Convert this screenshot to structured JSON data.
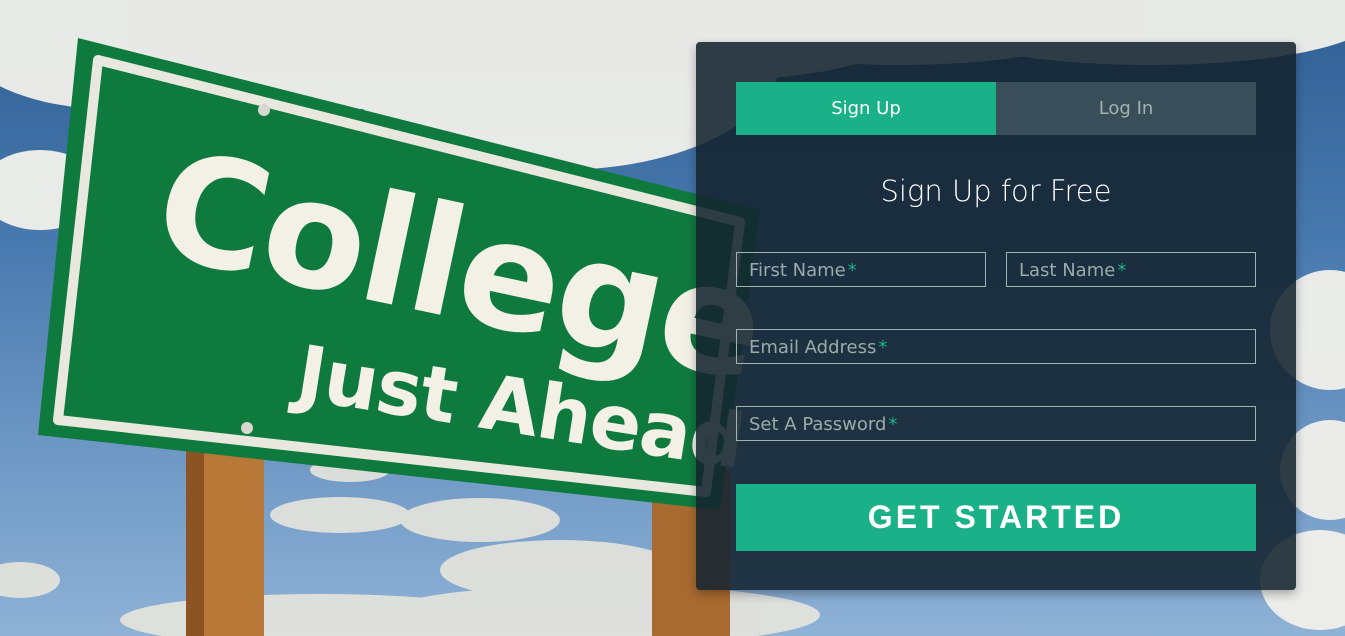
{
  "background": {
    "sign_line1": "College",
    "sign_line2": "Just Ahead"
  },
  "tabs": [
    {
      "label": "Sign Up",
      "active": true
    },
    {
      "label": "Log In",
      "active": false
    }
  ],
  "form": {
    "title": "Sign Up for Free",
    "first_name": {
      "placeholder": "First Name",
      "required_mark": "*"
    },
    "last_name": {
      "placeholder": "Last Name",
      "required_mark": "*"
    },
    "email": {
      "placeholder": "Email Address",
      "required_mark": "*"
    },
    "password": {
      "placeholder": "Set A Password",
      "required_mark": "*"
    },
    "submit_label": "GET STARTED"
  },
  "colors": {
    "accent": "#1ab188",
    "panel_bg": "#13232f",
    "muted_text": "#a0b3b0",
    "sign_green": "#0f7a3e"
  }
}
